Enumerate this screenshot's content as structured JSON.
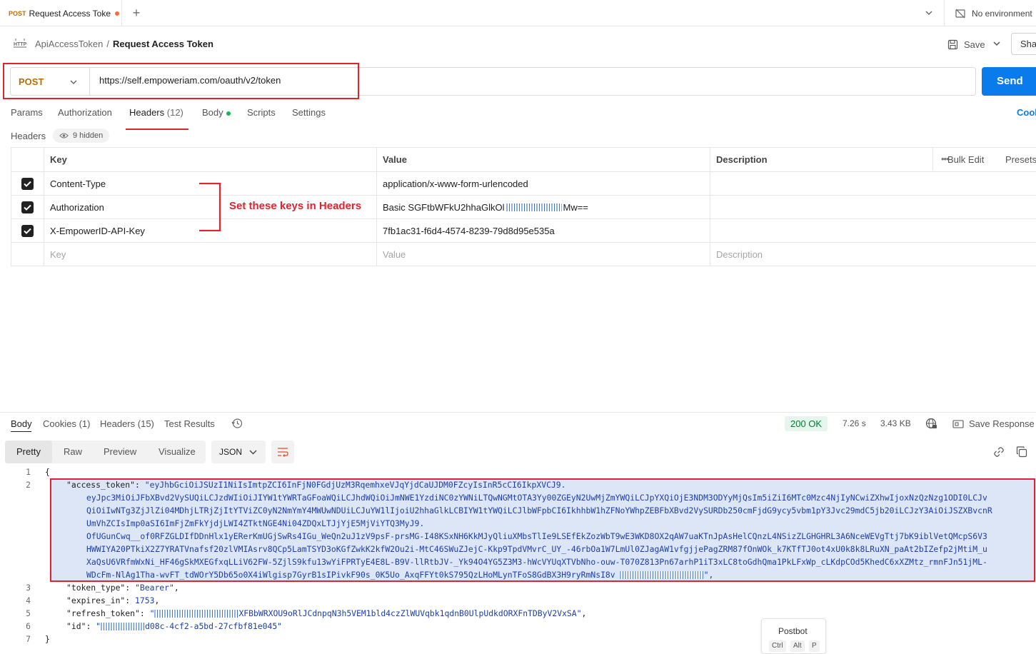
{
  "tab": {
    "method": "POST",
    "title": "Request Access Toke",
    "new_tab": "+"
  },
  "environment": {
    "label": "No environment"
  },
  "breadcrumb": {
    "parent": "ApiAccessToken",
    "separator": "/",
    "current": "Request Access Token"
  },
  "toolbar": {
    "save_label": "Save",
    "share_label": "Sha"
  },
  "request": {
    "method": "POST",
    "url": "https://self.empoweriam.com/oauth/v2/token",
    "send_label": "Send"
  },
  "req_tabs": {
    "params": "Params",
    "authorization": "Authorization",
    "headers": "Headers",
    "headers_count": "(12)",
    "body": "Body",
    "scripts": "Scripts",
    "settings": "Settings",
    "cookies": "Cook"
  },
  "headers_section": {
    "label": "Headers",
    "hidden": "9 hidden"
  },
  "table": {
    "columns": {
      "key": "Key",
      "value": "Value",
      "description": "Description"
    },
    "bulk_edit": "Bulk Edit",
    "presets": "Presets",
    "rows": [
      {
        "key": "Content-Type",
        "value": "application/x-www-form-urlencoded",
        "checked": true
      },
      {
        "key": "Authorization",
        "value": "Basic SGFtbWFkU2hhaGlkOl",
        "value_redacted": true,
        "value_suffix": "Mw==",
        "checked": true
      },
      {
        "key": "X-EmpowerID-API-Key",
        "value": "7fb1ac31-f6d4-4574-8239-79d8d95e535a",
        "checked": true
      }
    ],
    "placeholder": {
      "key": "Key",
      "value": "Value",
      "description": "Description"
    }
  },
  "annotation": {
    "text": "Set these keys in Headers",
    "color": "#e0232f"
  },
  "response": {
    "tabs": {
      "body": "Body",
      "cookies": "Cookies",
      "cookies_count": "(1)",
      "headers": "Headers",
      "headers_count": "(15)",
      "test_results": "Test Results"
    },
    "status": "200 OK",
    "time": "7.26 s",
    "size": "3.43 KB",
    "save_response": "Save Response",
    "views": {
      "pretty": "Pretty",
      "raw": "Raw",
      "preview": "Preview",
      "visualize": "Visualize"
    },
    "format": "JSON"
  },
  "code": {
    "line_numbers": [
      "1",
      "2",
      "3",
      "4",
      "5",
      "6",
      "7"
    ],
    "open_brace": "{",
    "close_brace": "}",
    "access_token_key": "\"access_token\"",
    "access_token_first": "eyJhbGciOiJSUzI1NiIsImtpZCI6InFjN0FGdjUzM3RqemhxeVJqYjdCaUJDM0FZcyIsInR5cCI6IkpXVCJ9.",
    "access_token_lines": [
      "eyJpc3MiOiJFbXBvd2VySUQiLCJzdWIiOiJIYW1tYWRTaGFoaWQiLCJhdWQiOiJmNWE1YzdiNC0zYWNiLTQwNGMtOTA3Yy00ZGEyN2UwMjZmYWQiLCJpYXQiOjE3NDM3ODYyMjQsIm5iZiI6MTc0Mzc4NjIyNCwiZXhwIjoxNzQzNzg1ODI0LCJv",
      "QiOiIwNTg3ZjJlZi04MDhjLTRjZjItYTViZC0yN2NmYmY4MWUwNDUiLCJuYW1lIjoiU2hhaGlkLCBIYW1tYWQiLCJlbWFpbCI6IkhhbW1hZFNoYWhpZEBFbXBvd2VySURDb250cmFjdG9ycy5vbm1pY3Jvc29mdC5jb20iLCJzY3AiOiJSZXBvcnR",
      "UmVhZCIsImp0aSI6ImFjZmFkYjdjLWI4ZTktNGE4Ni04ZDQxLTJjYjE5MjViYTQ3MyJ9.",
      "OfUGunCwq__of0RFZGLDIfDDnHlx1yERerKmUGjSwRs4IGu_WeQn2uJ1zV9psF-prsMG-I48KSxNH6KkMJyQliuXMbsTlIe9LSEfEkZozWbT9wE3WKD8OX2qAW7uaKTnJpAsHelCQnzL4NSizZLGHGHRL3A6NceWEVgTtj7bK9iblVetQMcpS6V3",
      "HWWIYA20PTkiX2Z7YRATVnafsf20zlVMIAsrv8QCp5LamTSYD3oKGfZwkK2kfW2Ou2i-MtC46SWuZJejC-Kkp9TpdVMvrC_UY_-46rbOa1W7LmUl0ZJagAW1vfgjjePagZRM87fOnWOk_k7KTfTJ0ot4xU0k8k8LRuXN_paAt2bIZefp2jMtiM_u",
      "XaQsU6VRfmWxNi_HF46gSkMXEGfxqLLiV62FW-5ZjlS9kfu13wYiFPRTyE4E8L-B9V-llRtbJV-_Yk94O4YG5Z3M3-hWcVYUqXTVbNho-ouw-T070Z813Pn67arhP1iT3xLC8toGdhQma1PkLFxWp_cLKdpCOd5KhedC6xXZMtz_rmnFJn51jML-",
      "WDcFm-NlAg1Tha-wvFT_tdWOrY5Db65o0X4iWlgisp7GyrB1sIPivkF90s_0K5Uo_AxqFFYt0kS795QzLHoMLynTFoS8GdBX3H9ryRmNsI8v"
    ],
    "token_type_key": "\"token_type\"",
    "token_type_val": "\"Bearer\"",
    "expires_in_key": "\"expires_in\"",
    "expires_in_val": "1753",
    "refresh_token_key": "\"refresh_token\"",
    "refresh_token_val": "XFBbWRXOU9oRlJCdnpqN3h5VEM1bld4czZlWUVqbk1qdnB0UlpUdkdORXFnTDByV2VxSA\"",
    "id_key": "\"id\"",
    "id_val": "d08c-4cf2-a5bd-27cfbf81e045\""
  },
  "postbot": {
    "label": "Postbot",
    "keys": [
      "Ctrl",
      "Alt",
      "P"
    ]
  }
}
